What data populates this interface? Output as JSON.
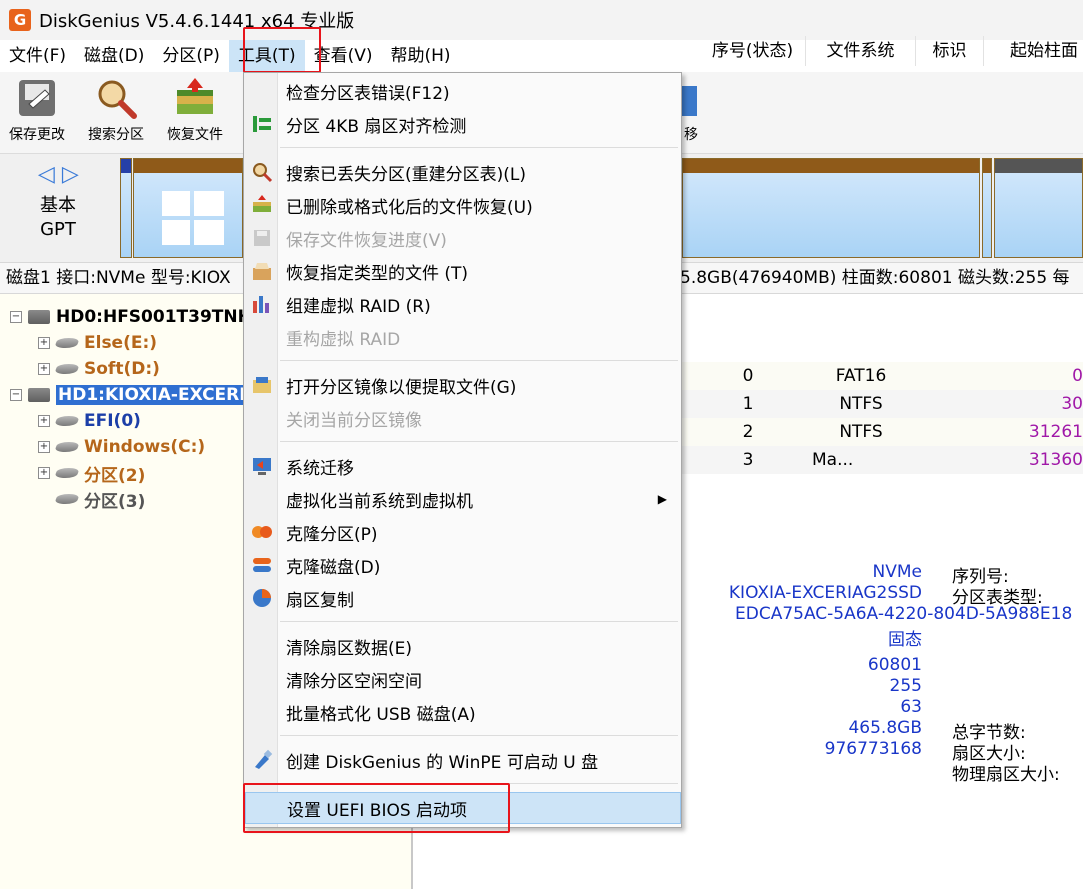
{
  "title": "DiskGenius V5.4.6.1441 x64 专业版",
  "app_icon_glyph": "G",
  "menubar": [
    "文件(F)",
    "磁盘(D)",
    "分区(P)",
    "工具(T)",
    "查看(V)",
    "帮助(H)"
  ],
  "toolbar": {
    "save": "保存更改",
    "search": "搜索分区",
    "recover": "恢复文件",
    "migrate_partial": "移"
  },
  "diskmap": {
    "arrows": "◁ ▷",
    "type_line1": "基本",
    "type_line2": "GPT"
  },
  "diskinfo": "磁盘1 接口:NVMe  型号:KIOXIA-EXCERIAG2SSD  容量:465.8GB(476940MB)  柱面数:60801  磁头数:255  每",
  "diskinfo_right": "5.8GB(476940MB)  柱面数:60801  磁头数:255  每",
  "diskinfo_left": "磁盘1 接口:NVMe  型号:KIOX",
  "tree": {
    "hd0": "HD0:HFS001T39TNH",
    "hd0_parts": [
      "Else(E:)",
      "Soft(D:)"
    ],
    "hd1": "HD1:KIOXIA-EXCERI",
    "hd1_parts": [
      "EFI(0)",
      "Windows(C:)",
      "分区(2)",
      "分区(3)"
    ]
  },
  "table": {
    "headers": [
      "序号(状态)",
      "文件系统",
      "标识",
      "起始柱面"
    ],
    "rows": [
      {
        "idx": "0",
        "fs": "FAT16",
        "flag": "",
        "start": "0"
      },
      {
        "idx": "1",
        "fs": "NTFS",
        "flag": "",
        "start": "30"
      },
      {
        "idx": "2",
        "fs": "NTFS",
        "flag": "",
        "start": "31261"
      },
      {
        "idx": "3",
        "fs": "Ma...",
        "flag": "",
        "start": "31360"
      }
    ]
  },
  "details": {
    "interface": "NVMe",
    "model": "KIOXIA-EXCERIAG2SSD",
    "guid": "EDCA75AC-5A6A-4220-804D-5A988E18",
    "type": "固态",
    "cylinders": "60801",
    "heads": "255",
    "sectors": "63",
    "capacity": "465.8GB",
    "total_sectors": "976773168",
    "serial_label": "序列号:",
    "table_type_label": "分区表类型:",
    "total_bytes_label": "总字节数:",
    "sector_size_label": "扇区大小:",
    "phys_sector_label": "物理扇区大小:"
  },
  "dropdown": {
    "items": [
      "检查分区表错误(F12)",
      "分区 4KB 扇区对齐检测",
      "搜索已丢失分区(重建分区表)(L)",
      "已删除或格式化后的文件恢复(U)",
      "保存文件恢复进度(V)",
      "恢复指定类型的文件 (T)",
      "组建虚拟 RAID (R)",
      "重构虚拟 RAID",
      "打开分区镜像以便提取文件(G)",
      "关闭当前分区镜像",
      "系统迁移",
      "虚拟化当前系统到虚拟机",
      "克隆分区(P)",
      "克隆磁盘(D)",
      "扇区复制",
      "清除扇区数据(E)",
      "清除分区空闲空间",
      "批量格式化 USB 磁盘(A)",
      "创建 DiskGenius 的 WinPE 可启动 U 盘",
      "设置 UEFI BIOS 启动项"
    ],
    "submenu_arrow": "▶"
  },
  "colors": {
    "highlight_box": "#e8141b",
    "selection": "#2f6fd1",
    "menu_hover": "#cde4f7",
    "partition_bar": "#8f5a19"
  }
}
